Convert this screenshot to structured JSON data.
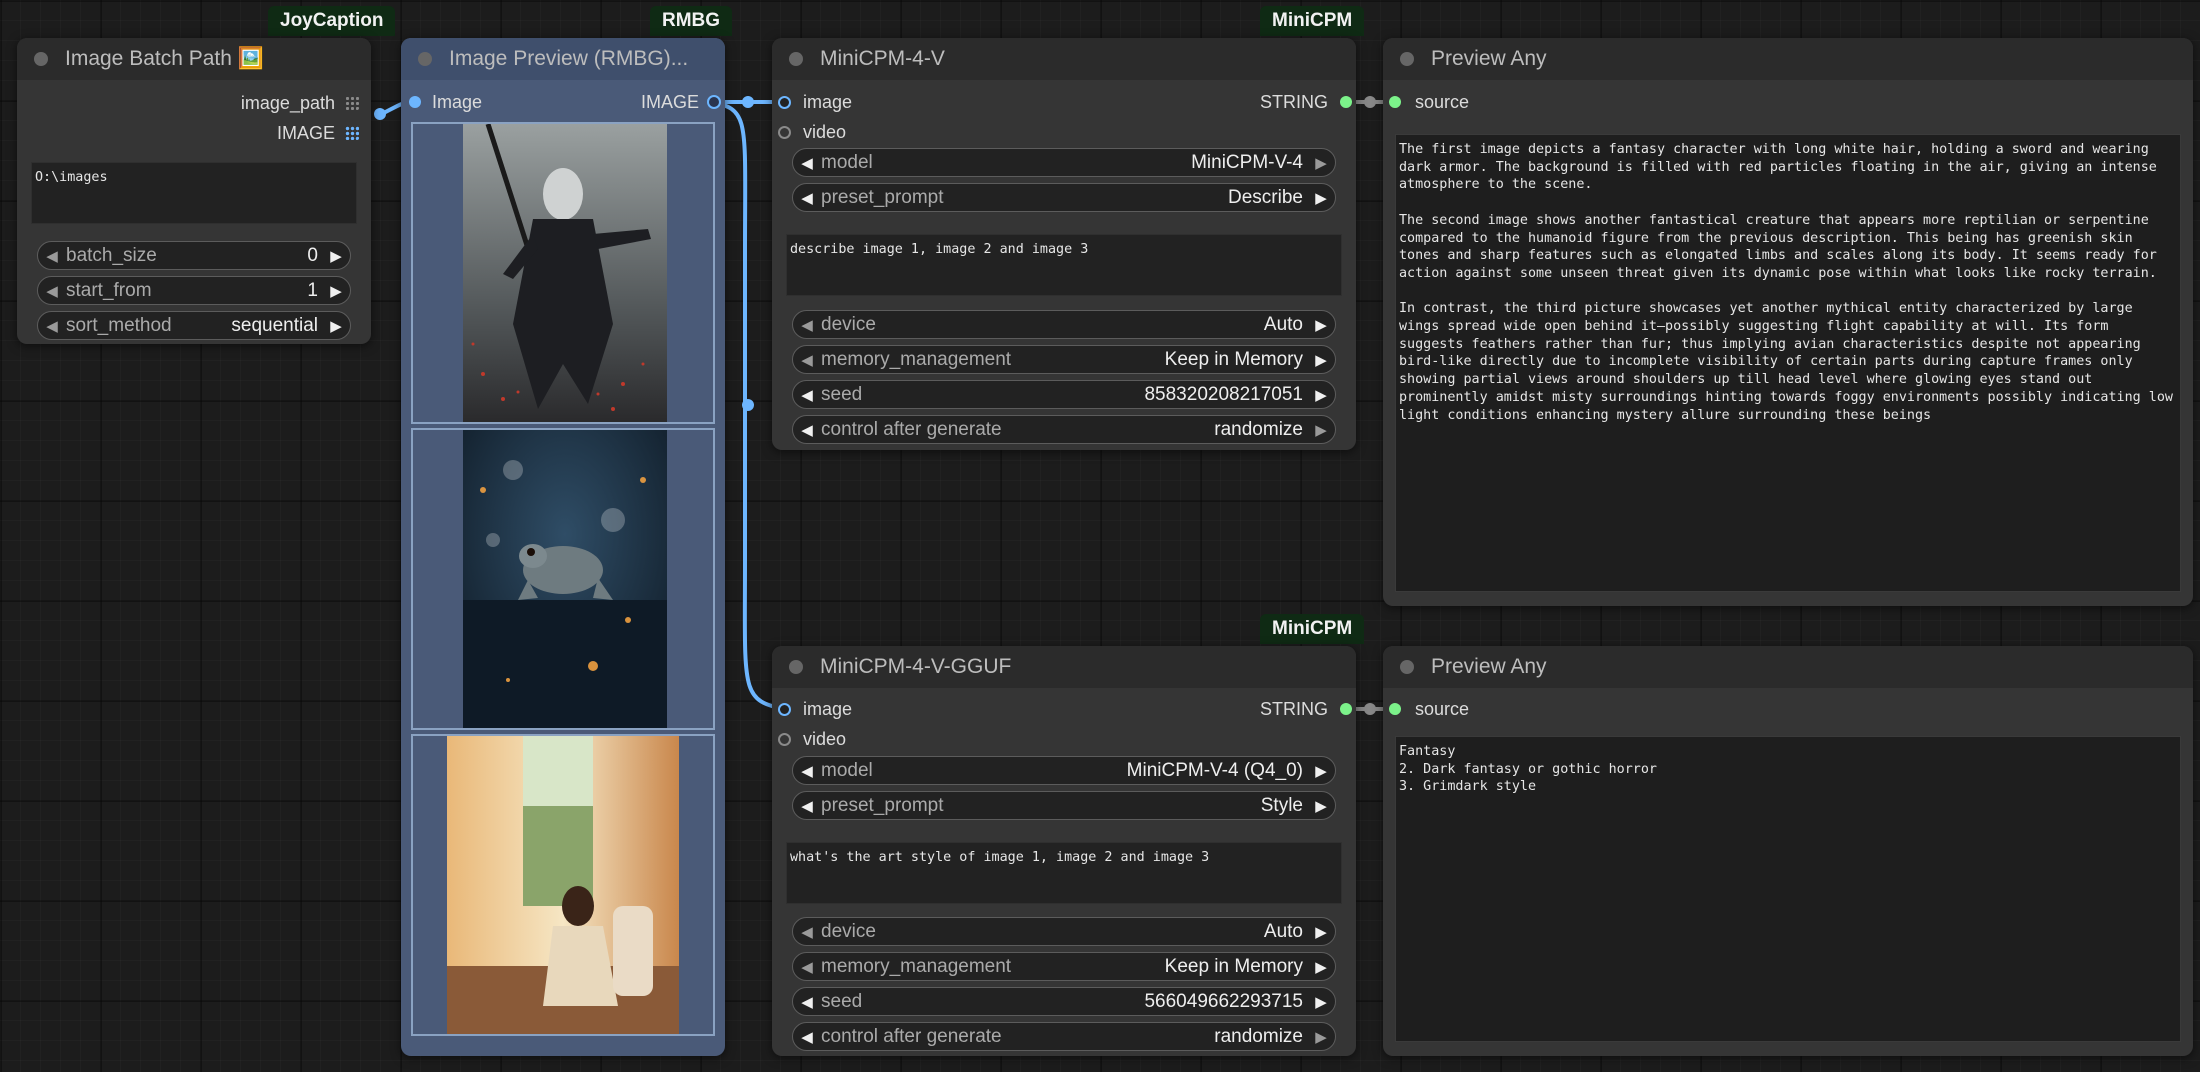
{
  "badges": {
    "joycaption": "JoyCaption",
    "rmbg": "RMBG",
    "minicpm_top": "MiniCPM",
    "minicpm_bottom": "MiniCPM"
  },
  "batch_node": {
    "title": "Image Batch Path 🖼️",
    "outputs": [
      "image_path",
      "IMAGE"
    ],
    "path_value": "O:\\images",
    "widgets": [
      {
        "label": "batch_size",
        "value": "0"
      },
      {
        "label": "start_from",
        "value": "1"
      },
      {
        "label": "sort_method",
        "value": "sequential"
      }
    ]
  },
  "preview_rmbg": {
    "title": "Image Preview (RMBG)...",
    "input": "Image",
    "output": "IMAGE",
    "images": [
      "dark-armored-warrior-image",
      "frog-bokeh-image",
      "woman-by-window-image"
    ]
  },
  "minicpm_top": {
    "title": "MiniCPM-4-V",
    "inputs": [
      "image",
      "video"
    ],
    "output": "STRING",
    "widgets": [
      {
        "label": "model",
        "value": "MiniCPM-V-4"
      },
      {
        "label": "preset_prompt",
        "value": "Describe"
      }
    ],
    "prompt": "describe image 1, image 2 and image 3",
    "widgets2": [
      {
        "label": "device",
        "value": "Auto"
      },
      {
        "label": "memory_management",
        "value": "Keep in Memory"
      },
      {
        "label": "seed",
        "value": "858320208217051"
      },
      {
        "label": "control after generate",
        "value": "randomize"
      }
    ]
  },
  "minicpm_bottom": {
    "title": "MiniCPM-4-V-GGUF",
    "inputs": [
      "image",
      "video"
    ],
    "output": "STRING",
    "widgets": [
      {
        "label": "model",
        "value": "MiniCPM-V-4 (Q4_0)"
      },
      {
        "label": "preset_prompt",
        "value": "Style"
      }
    ],
    "prompt": "what's the art style of image 1, image 2 and image 3",
    "widgets2": [
      {
        "label": "device",
        "value": "Auto"
      },
      {
        "label": "memory_management",
        "value": "Keep in Memory"
      },
      {
        "label": "seed",
        "value": "566049662293715"
      },
      {
        "label": "control after generate",
        "value": "randomize"
      }
    ]
  },
  "preview_any_top": {
    "title": "Preview Any",
    "input": "source",
    "text": "The first image depicts a fantasy character with long white hair, holding a sword and wearing dark armor. The background is filled with red particles floating in the air, giving an intense atmosphere to the scene.\n\nThe second image shows another fantastical creature that appears more reptilian or serpentine compared to the humanoid figure from the previous description. This being has greenish skin tones and sharp features such as elongated limbs and scales along its body. It seems ready for action against some unseen threat given its dynamic pose within what looks like rocky terrain.\n\nIn contrast, the third picture showcases yet another mythical entity characterized by large wings spread wide open behind it—possibly suggesting flight capability at will. Its form suggests feathers rather than fur; thus implying avian characteristics despite not appearing bird-like directly due to incomplete visibility of certain parts during capture frames only showing partial views around shoulders up till head level where glowing eyes stand out prominently amidst misty surroundings hinting towards foggy environments possibly indicating low light conditions enhancing mystery allure surrounding these beings"
  },
  "preview_any_bottom": {
    "title": "Preview Any",
    "input": "source",
    "text": "Fantasy\n2. Dark fantasy or gothic horror\n3. Grimdark style"
  },
  "colors": {
    "image_link": "#6db6ff",
    "string_link": "#7cf28a",
    "badge_bg": "#0f2a14",
    "rmbg_node": "#4a5a78"
  }
}
